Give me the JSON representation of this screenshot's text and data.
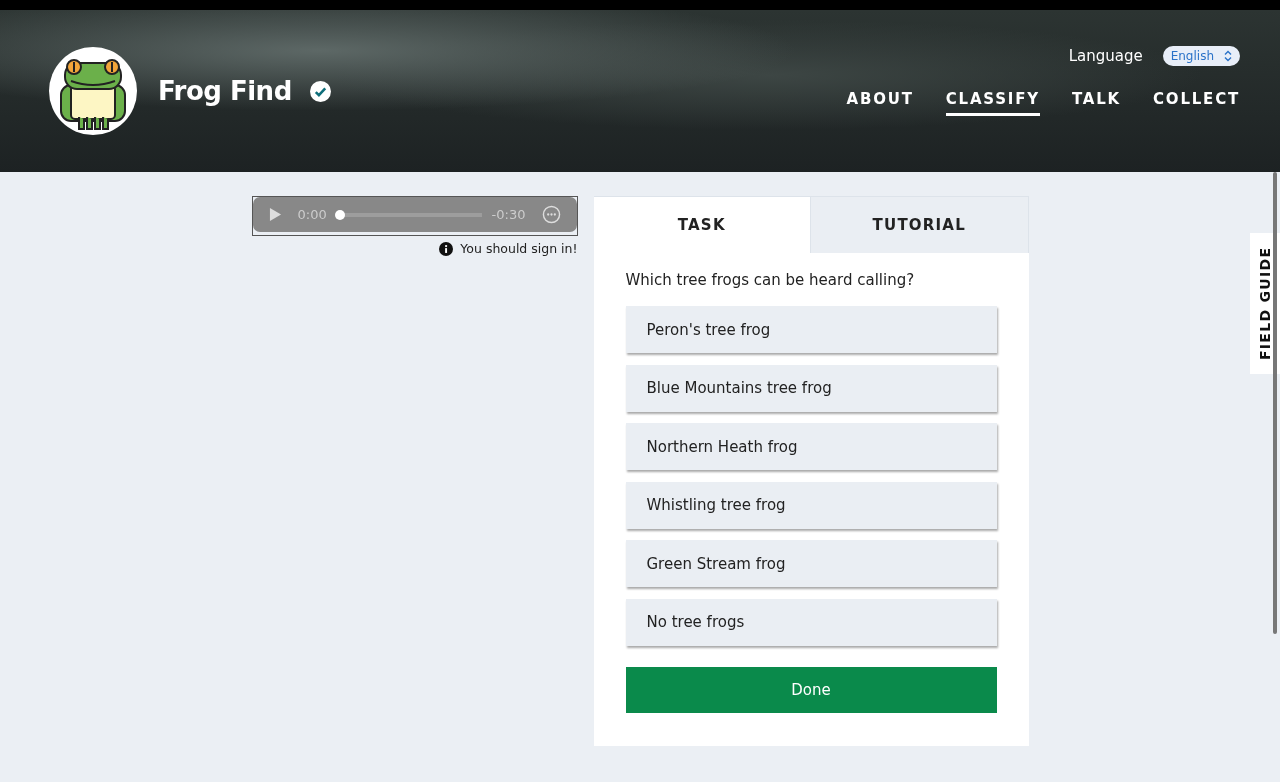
{
  "header": {
    "title": "Frog Find",
    "language_label": "Language",
    "language_value": "English",
    "nav": [
      {
        "label": "ABOUT",
        "selected": false
      },
      {
        "label": "CLASSIFY",
        "selected": true
      },
      {
        "label": "TALK",
        "selected": false
      },
      {
        "label": "COLLECT",
        "selected": false
      }
    ]
  },
  "player": {
    "time_elapsed": "0:00",
    "time_remaining": "-0:30",
    "level": 0
  },
  "notice": "You should sign in!",
  "tabs": [
    {
      "label": "TASK",
      "selected": true
    },
    {
      "label": "TUTORIAL",
      "selected": false
    }
  ],
  "question": "Which tree frogs can be heard calling?",
  "answers": [
    {
      "label": "Peron's tree frog",
      "selected": false
    },
    {
      "label": "Blue Mountains tree frog",
      "selected": false
    },
    {
      "label": "Northern Heath frog",
      "selected": false
    },
    {
      "label": "Whistling tree frog",
      "selected": false
    },
    {
      "label": "Green Stream frog",
      "selected": false
    },
    {
      "label": "No tree frogs",
      "selected": false
    }
  ],
  "done_button": "Done",
  "field_guide": "FIELD GUIDE"
}
